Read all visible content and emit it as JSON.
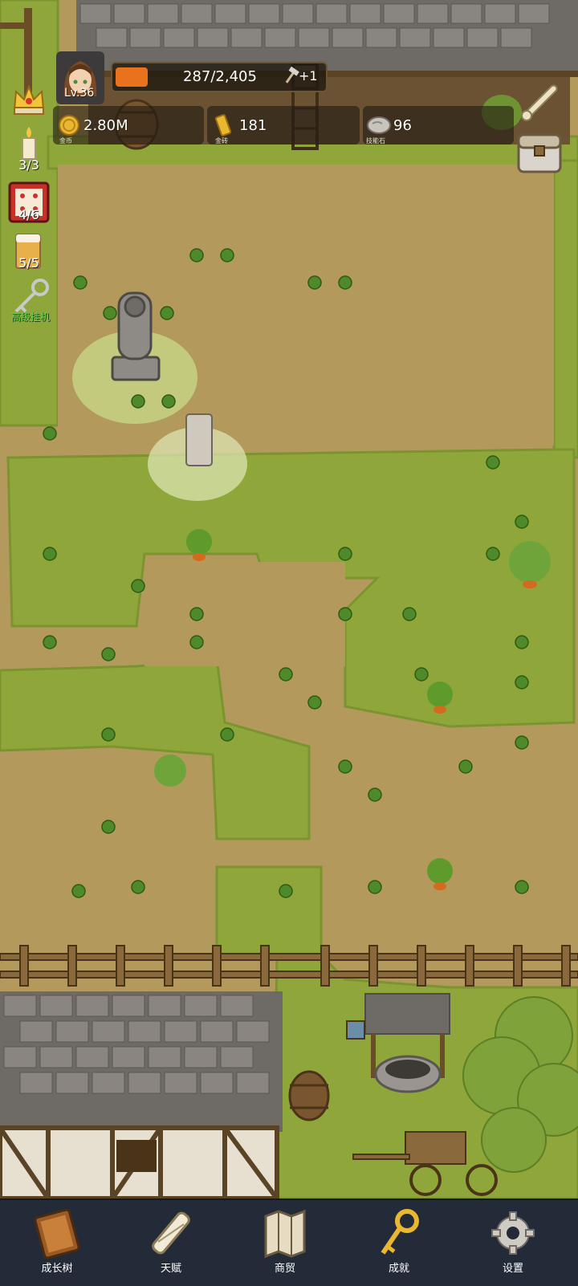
{
  "player": {
    "level": "Lv.36",
    "xp_text": "287/2,405",
    "xp_fraction": 0.12,
    "xp_bonus": "+1"
  },
  "resources": [
    {
      "icon": "gold-coin-icon",
      "label": "金币",
      "value": "2.80M"
    },
    {
      "icon": "gold-bar-icon",
      "label": "金砖",
      "value": "181"
    },
    {
      "icon": "skill-stone-icon",
      "label": "技能石",
      "value": "96"
    }
  ],
  "side_buttons": {
    "candle_count": "3/3",
    "dice_count": "4/6",
    "beer_count": "5/5",
    "idle_label": "高级挂机"
  },
  "bottom_nav": [
    {
      "icon": "growth-tree-book-icon",
      "label": "成长树"
    },
    {
      "icon": "talent-scroll-icon",
      "label": "天赋"
    },
    {
      "icon": "trade-map-icon",
      "label": "商贸"
    },
    {
      "icon": "achievement-key-icon",
      "label": "成就"
    },
    {
      "icon": "settings-gear-icon",
      "label": "设置"
    }
  ],
  "colors": {
    "dirt": "#b39a5c",
    "grass": "#8ea63a",
    "xp_fill": "#e8731c",
    "nav_bg": "#232a38",
    "idle_label": "#5ed84a"
  }
}
